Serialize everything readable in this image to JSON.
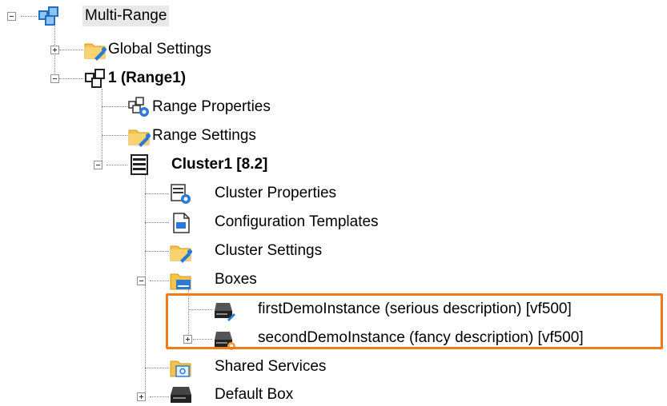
{
  "tree": {
    "root": {
      "label": "Multi-Range",
      "icon": "multi-range-icon"
    },
    "global_settings": {
      "label": "Global Settings",
      "icon": "folder-wrench-icon"
    },
    "range1": {
      "label": "1 (Range1)",
      "icon": "range-icon"
    },
    "range_properties": {
      "label": "Range Properties",
      "icon": "range-properties-icon"
    },
    "range_settings": {
      "label": "Range Settings",
      "icon": "folder-wrench-icon"
    },
    "cluster1": {
      "label": "Cluster1 [8.2]",
      "icon": "cluster-icon"
    },
    "cluster_properties": {
      "label": "Cluster Properties",
      "icon": "cluster-properties-icon"
    },
    "configuration_templates": {
      "label": "Configuration Templates",
      "icon": "document-icon"
    },
    "cluster_settings": {
      "label": "Cluster Settings",
      "icon": "folder-wrench-icon"
    },
    "boxes": {
      "label": "Boxes",
      "icon": "folder-box-icon"
    },
    "first_instance": {
      "label": "firstDemoInstance (serious description) [vf500]",
      "icon": "box-instance-icon"
    },
    "second_instance": {
      "label": "secondDemoInstance (fancy description) [vf500]",
      "icon": "box-instance-icon"
    },
    "shared_services": {
      "label": "Shared Services",
      "icon": "folder-services-icon"
    },
    "default_box": {
      "label": "Default Box",
      "icon": "box-icon"
    }
  },
  "colors": {
    "highlight_border": "#f07a1a",
    "folder_yellow": "#f5c24a",
    "wrench_blue": "#2b7bd6",
    "selection_gray": "#e8e8e8"
  }
}
